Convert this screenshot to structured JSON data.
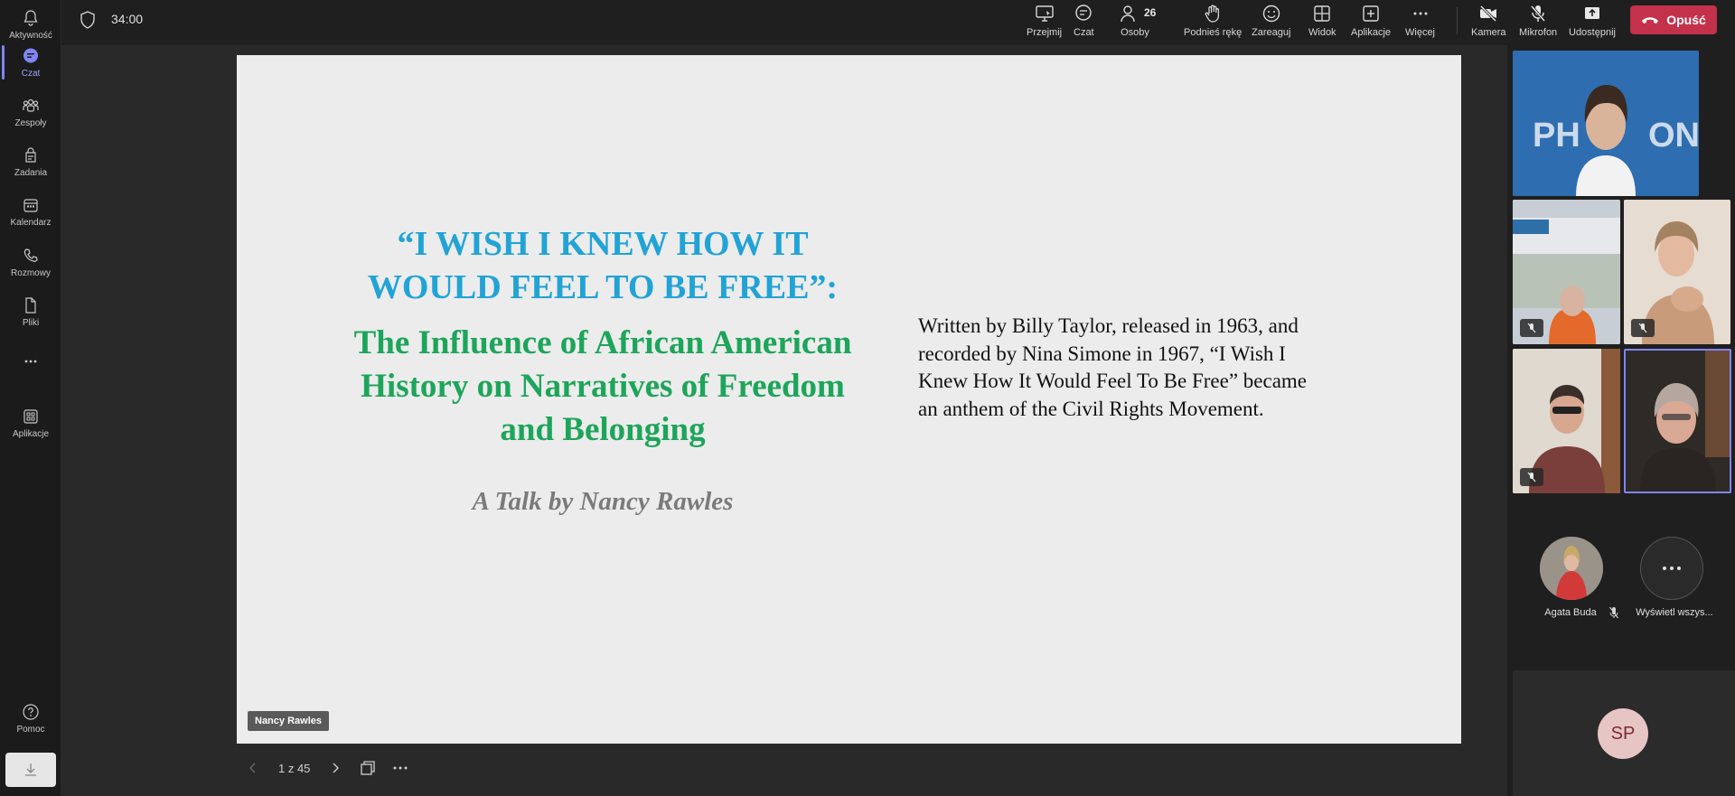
{
  "rail": {
    "items": [
      {
        "label": "Aktywność"
      },
      {
        "label": "Czat"
      },
      {
        "label": "Zespoły"
      },
      {
        "label": "Zadania"
      },
      {
        "label": "Kalendarz"
      },
      {
        "label": "Rozmowy"
      },
      {
        "label": "Pliki"
      },
      {
        "label": ""
      },
      {
        "label": "Aplikacje"
      }
    ],
    "help_label": "Pomoc",
    "active_item": "Czat"
  },
  "meeting": {
    "timer": "34:00",
    "people_count": "26"
  },
  "toolbar": {
    "take_control": "Przejmij",
    "chat": "Czat",
    "people": "Osoby",
    "raise_hand": "Podnieś rękę",
    "react": "Zareaguj",
    "view": "Widok",
    "apps": "Aplikacje",
    "more": "Więcej",
    "camera": "Kamera",
    "microphone": "Mikrofon",
    "share": "Udostępnij",
    "leave": "Opuść"
  },
  "slide": {
    "title": "“I WISH I KNEW HOW IT WOULD FEEL TO BE FREE”:",
    "subtitle": "The Influence of African American History on Narratives of Freedom and Belonging",
    "byline": "A Talk by Nancy Rawles",
    "body": "Written by Billy Taylor, released in 1963, and recorded by Nina Simone in 1967, “I Wish I Knew How It Would Feel To Be Free” became an anthem of the Civil Rights Movement.",
    "presenter": "Nancy Rawles",
    "page_indicator": "1 z 45"
  },
  "participants": {
    "agata_name": "Agata Buda",
    "view_all_label": "Wyświetl wszys...",
    "self_initials": "SP"
  },
  "colors": {
    "accent": "#7f85f5",
    "leave": "#c4314b",
    "slide_title": "#21a3d6",
    "slide_subtitle": "#1da55a"
  }
}
